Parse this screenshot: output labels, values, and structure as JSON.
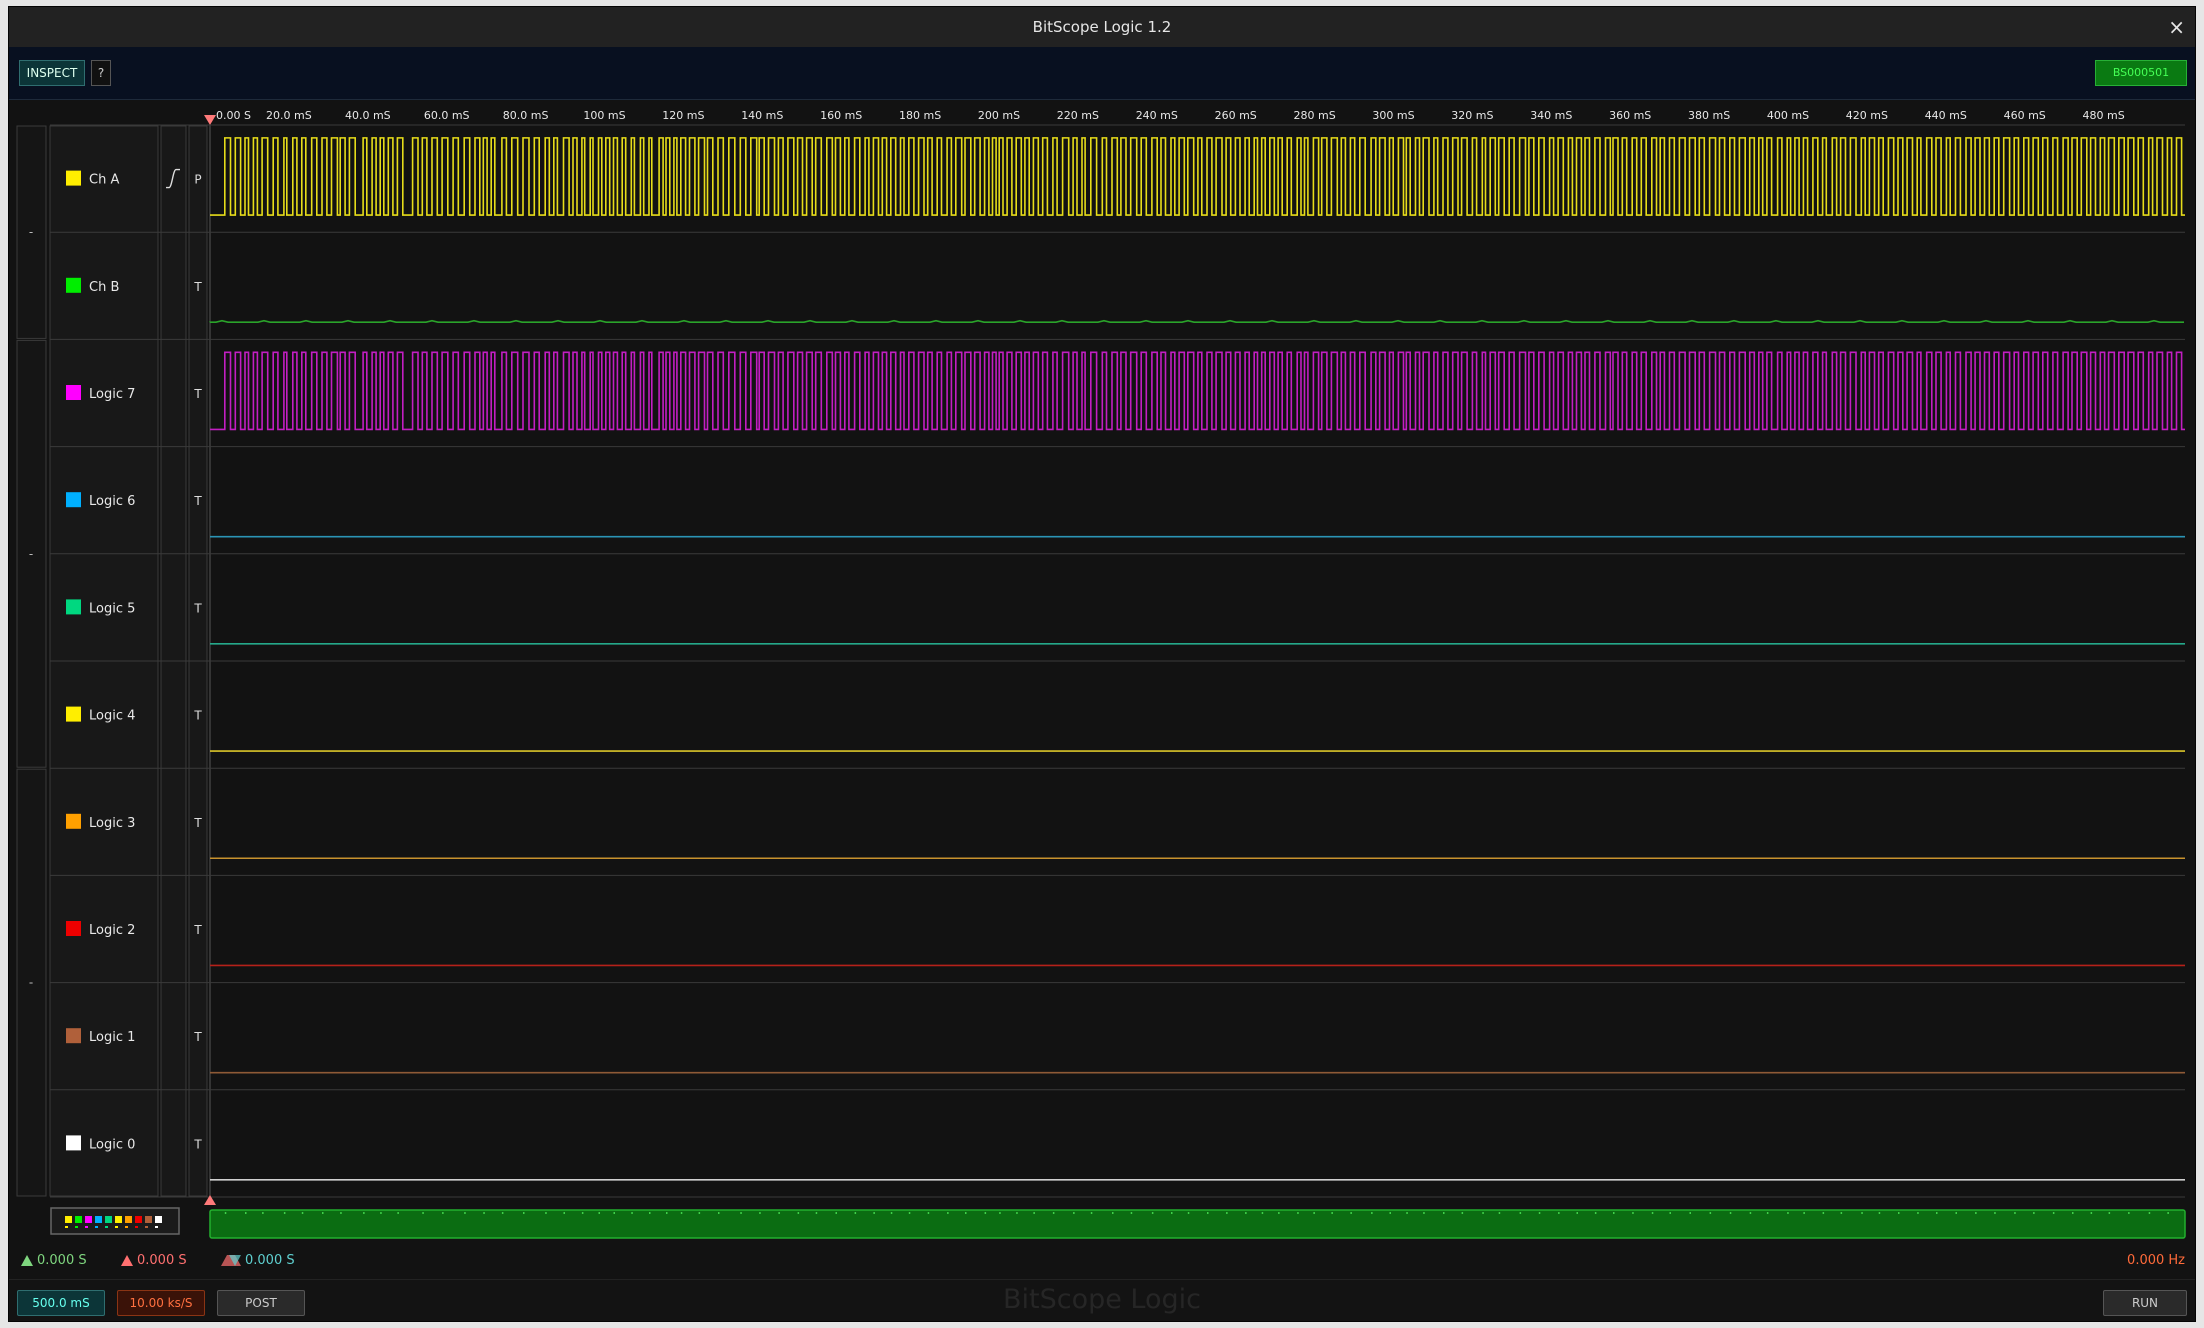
{
  "window": {
    "title": "BitScope Logic 1.2",
    "close_glyph": "×"
  },
  "toolbar": {
    "inspect_label": "INSPECT",
    "help_label": "?",
    "device_label": "BS000501"
  },
  "timeline": {
    "ticks": [
      "0.00  S",
      "20.0 mS",
      "40.0 mS",
      "60.0 mS",
      "80.0 mS",
      "100 mS",
      "120 mS",
      "140 mS",
      "160 mS",
      "180 mS",
      "200 mS",
      "220 mS",
      "240 mS",
      "260 mS",
      "280 mS",
      "300 mS",
      "320 mS",
      "340 mS",
      "360 mS",
      "380 mS",
      "400 mS",
      "420 mS",
      "440 mS",
      "460 mS",
      "480 mS"
    ]
  },
  "groups": [
    {
      "label": "-"
    },
    {
      "label": "-"
    },
    {
      "label": "-"
    }
  ],
  "channels": [
    {
      "name": "Ch A",
      "color": "#ffee00",
      "trace_color": "#e6dc1a",
      "mode": "P",
      "signal": "pulses",
      "edge_icon": "rising-edge-icon"
    },
    {
      "name": "Ch B",
      "color": "#00ee00",
      "trace_color": "#2aa32a",
      "mode": "T",
      "signal": "noise-low"
    },
    {
      "name": "Logic 7",
      "color": "#ff00ff",
      "trace_color": "#c21ec2",
      "mode": "T",
      "signal": "pulses"
    },
    {
      "name": "Logic 6",
      "color": "#00b0ff",
      "trace_color": "#2b94b5",
      "mode": "T",
      "signal": "low"
    },
    {
      "name": "Logic 5",
      "color": "#00d880",
      "trace_color": "#25a88a",
      "mode": "T",
      "signal": "low"
    },
    {
      "name": "Logic 4",
      "color": "#ffee00",
      "trace_color": "#d9c42a",
      "mode": "T",
      "signal": "low"
    },
    {
      "name": "Logic 3",
      "color": "#ffa000",
      "trace_color": "#c8922e",
      "mode": "T",
      "signal": "low"
    },
    {
      "name": "Logic 2",
      "color": "#ee0000",
      "trace_color": "#b5211a",
      "mode": "T",
      "signal": "low"
    },
    {
      "name": "Logic 1",
      "color": "#b0603a",
      "trace_color": "#8e5a36",
      "mode": "T",
      "signal": "low"
    },
    {
      "name": "Logic 0",
      "color": "#ffffff",
      "trace_color": "#d0d0d0",
      "mode": "T",
      "signal": "low"
    }
  ],
  "pulse_edges": [
    0.0075,
    0.0104,
    0.0128,
    0.0155,
    0.0177,
    0.0195,
    0.022,
    0.024,
    0.0264,
    0.0292,
    0.032,
    0.0344,
    0.0374,
    0.0389,
    0.0419,
    0.044,
    0.0465,
    0.0485,
    0.0515,
    0.0541,
    0.0567,
    0.0592,
    0.0615,
    0.0645,
    0.0659,
    0.0684,
    0.0706,
    0.0735,
    0.0775,
    0.0794,
    0.0821,
    0.0841,
    0.0862,
    0.088,
    0.0903,
    0.0926,
    0.0949,
    0.0976,
    0.1026,
    0.1053,
    0.1075,
    0.1098,
    0.1124,
    0.1151,
    0.1175,
    0.1204,
    0.1231,
    0.1257,
    0.1287,
    0.1315,
    0.1342,
    0.1366,
    0.1384,
    0.1403,
    0.1424,
    0.1442,
    0.1478,
    0.1501,
    0.1528,
    0.1558,
    0.1585,
    0.1615,
    0.1642,
    0.1667,
    0.1697,
    0.1718,
    0.1741,
    0.1759,
    0.179,
    0.1818,
    0.1838,
    0.1858,
    0.1883,
    0.1897,
    0.1925,
    0.1939,
    0.1967,
    0.1984,
    0.2004,
    0.2024,
    0.2043,
    0.2063,
    0.2087,
    0.2105,
    0.2133,
    0.2149,
    0.2179,
    0.2196,
    0.2223,
    0.2237,
    0.2274,
    0.2294,
    0.2309,
    0.2328,
    0.2349,
    0.2364,
    0.2384,
    0.2408,
    0.2428,
    0.2455,
    0.2474,
    0.2504,
    0.2519,
    0.2546,
    0.2572,
    0.2599,
    0.2627,
    0.2657,
    0.2685,
    0.2713,
    0.2738,
    0.2768,
    0.2781,
    0.2806,
    0.2828,
    0.2858,
    0.2878,
    0.2902,
    0.2926,
    0.2956,
    0.2975,
    0.3,
    0.3021,
    0.3049,
    0.3067,
    0.3095,
    0.3123,
    0.3151,
    0.3167,
    0.3192,
    0.3214,
    0.3235,
    0.3264,
    0.329,
    0.3317,
    0.3336,
    0.3359,
    0.3385,
    0.3404,
    0.3426,
    0.3447,
    0.3472,
    0.3496,
    0.3514,
    0.3538,
    0.3564,
    0.3588,
    0.3615,
    0.3634,
    0.3656,
    0.3682,
    0.3704,
    0.3732,
    0.3754,
    0.3776,
    0.3806,
    0.3823,
    0.3852,
    0.3872,
    0.3899,
    0.3922,
    0.3944,
    0.3962,
    0.398,
    0.3996,
    0.4015,
    0.4036,
    0.406,
    0.4082,
    0.4108,
    0.4126,
    0.4148,
    0.4169,
    0.4194,
    0.4216,
    0.424,
    0.4268,
    0.4289,
    0.4317,
    0.4348,
    0.437,
    0.439,
    0.4415,
    0.4431,
    0.446,
    0.4489,
    0.4518,
    0.4539,
    0.4567,
    0.4594,
    0.4612,
    0.4638,
    0.4662,
    0.4692,
    0.4715,
    0.4741,
    0.4769,
    0.4796,
    0.4815,
    0.4838,
    0.4866,
    0.4885,
    0.4907,
    0.4933,
    0.4951,
    0.4981,
    0.5002,
    0.5022,
    0.5048,
    0.5073,
    0.5094,
    0.5124,
    0.5145,
    0.5168,
    0.5192,
    0.5215,
    0.5241,
    0.5262,
    0.5287,
    0.5304,
    0.5325,
    0.5343,
    0.5366,
    0.5389,
    0.5408,
    0.5429,
    0.5454,
    0.5475,
    0.5505,
    0.5524,
    0.5542,
    0.5559,
    0.5587,
    0.5613,
    0.5629,
    0.5655,
    0.5678,
    0.5708,
    0.5728,
    0.5749,
    0.5774,
    0.5796,
    0.5822,
    0.5849,
    0.5879,
    0.5903,
    0.5922,
    0.595,
    0.5972,
    0.5991,
    0.6017,
    0.6043,
    0.6057,
    0.6077,
    0.6104,
    0.6124,
    0.6143,
    0.6172,
    0.6197,
    0.6216,
    0.6243,
    0.6268,
    0.6292,
    0.6319,
    0.6337,
    0.6365,
    0.6392,
    0.6413,
    0.6442,
    0.6458,
    0.6482,
    0.6508,
    0.6525,
    0.6553,
    0.6578,
    0.6603,
    0.6631,
    0.6661,
    0.6678,
    0.6703,
    0.6728,
    0.6755,
    0.6783,
    0.6803,
    0.6826,
    0.6852,
    0.6878,
    0.6898,
    0.6919,
    0.6944,
    0.6962,
    0.6985,
    0.7012,
    0.7038,
    0.7066,
    0.709,
    0.7104,
    0.7129,
    0.7151,
    0.7173,
    0.7201,
    0.7224,
    0.7247,
    0.7272,
    0.73,
    0.7324,
    0.7343,
    0.7364,
    0.739,
    0.7414,
    0.744,
    0.7469,
    0.7491,
    0.752,
    0.7541,
    0.7566,
    0.7593,
    0.7623,
    0.7643,
    0.7669,
    0.7695,
    0.7719,
    0.7744,
    0.7773,
    0.7796,
    0.7819,
    0.7842,
    0.7862,
    0.7883,
    0.7907,
    0.7937,
    0.7959,
    0.7986,
    0.8003,
    0.8025,
    0.8046,
    0.8068,
    0.8089,
    0.8116,
    0.8141,
    0.8165,
    0.8184,
    0.8214,
    0.8236,
    0.8256,
    0.8281,
    0.8306,
    0.8334,
    0.8361,
    0.8381,
    0.8402,
    0.8428,
    0.8449,
    0.8472,
    0.8498,
    0.8525,
    0.8547,
    0.8571,
    0.8593,
    0.862,
    0.8644,
    0.8663,
    0.8692,
    0.8718,
    0.8739,
    0.8765,
    0.8792,
    0.8811,
    0.8838,
    0.8863,
    0.8891,
    0.8917,
    0.8937,
    0.8962,
    0.8985,
    0.9009,
    0.9034,
    0.9057,
    0.9082,
    0.9112,
    0.9135,
    0.9157,
    0.9184,
    0.9208,
    0.9231,
    0.9257,
    0.928,
    0.9305,
    0.9331,
    0.9355,
    0.9383,
    0.9408,
    0.9428,
    0.9454,
    0.9475,
    0.9503,
    0.9522,
    0.9547,
    0.9571,
    0.9593,
    0.9613,
    0.9642,
    0.9665,
    0.9692,
    0.9712,
    0.9741,
    0.9763,
    0.9789,
    0.9816,
    0.9836,
    0.9858,
    0.9886,
    0.9911,
    0.9932,
    0.9957,
    0.9983
  ],
  "overview": {
    "channel_colors": [
      "#ffee00",
      "#00ee00",
      "#ff00ff",
      "#00b0ff",
      "#00d880",
      "#ffee00",
      "#ffa000",
      "#ee0000",
      "#b0603a",
      "#ffffff"
    ]
  },
  "status": {
    "cursor1": "0.000  S",
    "cursor1_color": "#7fd67f",
    "cursor2": "0.000  S",
    "cursor2_color": "#ff7070",
    "delta": "0.000  S",
    "delta_color": "#5fd0d0",
    "frequency": "0.000  Hz",
    "frequency_color": "#ff6a3a"
  },
  "bottom": {
    "timebase": "500.0 mS",
    "rate": "10.00 ks/S",
    "post_label": "POST",
    "run_label": "RUN",
    "watermark": "BitScope Logic"
  }
}
